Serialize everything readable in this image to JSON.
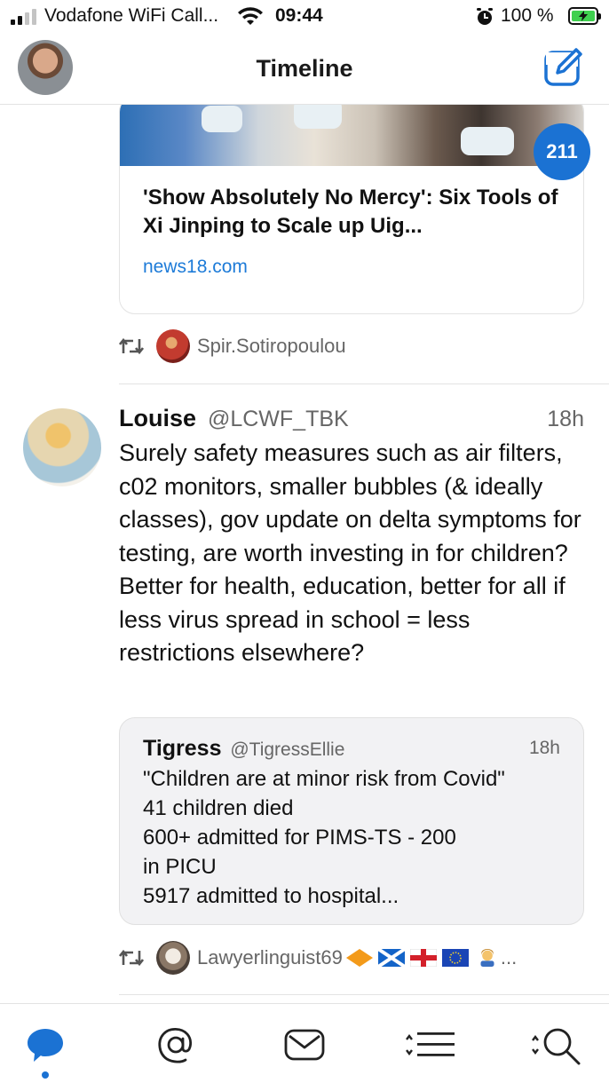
{
  "status_bar": {
    "carrier": "Vodafone WiFi Call...",
    "time": "09:44",
    "battery_percent": "100 %"
  },
  "nav": {
    "title": "Timeline",
    "compose_icon": "compose-icon",
    "avatar_icon": "avatar"
  },
  "unread_count": "211",
  "link_card": {
    "title": "'Show Absolutely No Mercy': Six Tools of Xi Jinping to Scale up Uig...",
    "domain": "news18.com"
  },
  "retweet_1": {
    "user": "Spir.Sotiropoulou",
    "icon": "retweet-icon"
  },
  "tweet": {
    "name": "Louise",
    "handle": "@LCWF_TBK",
    "time": "18h",
    "text": "Surely safety measures such as air filters, c02 monitors, smaller bubbles (& ideally classes), gov update on delta symptoms for testing, are worth investing in for children? Better for health, education, better for all if less virus spread in school = less restrictions elsewhere?"
  },
  "quote": {
    "name": "Tigress",
    "handle": "@TigressEllie",
    "time": "18h",
    "text": "\"Children are at minor risk from Covid\"\n41 children died\n600+ admitted for PIMS-TS - 200\nin PICU\n5917 admitted to hospital..."
  },
  "retweet_2": {
    "user": "Lawyerlinguist69",
    "suffix": "...",
    "icon": "retweet-icon"
  },
  "tabs": [
    {
      "name": "timeline",
      "icon": "speech-bubble-icon",
      "active": true
    },
    {
      "name": "mentions",
      "icon": "at-sign-icon"
    },
    {
      "name": "messages",
      "icon": "envelope-icon"
    },
    {
      "name": "lists",
      "icon": "list-icon"
    },
    {
      "name": "search",
      "icon": "magnifier-icon"
    }
  ],
  "colors": {
    "accent": "#1b72d3",
    "link": "#1d7bd8",
    "secondary_text": "#666666",
    "quote_background": "#f2f2f4",
    "battery_fill": "#3fd04f"
  }
}
